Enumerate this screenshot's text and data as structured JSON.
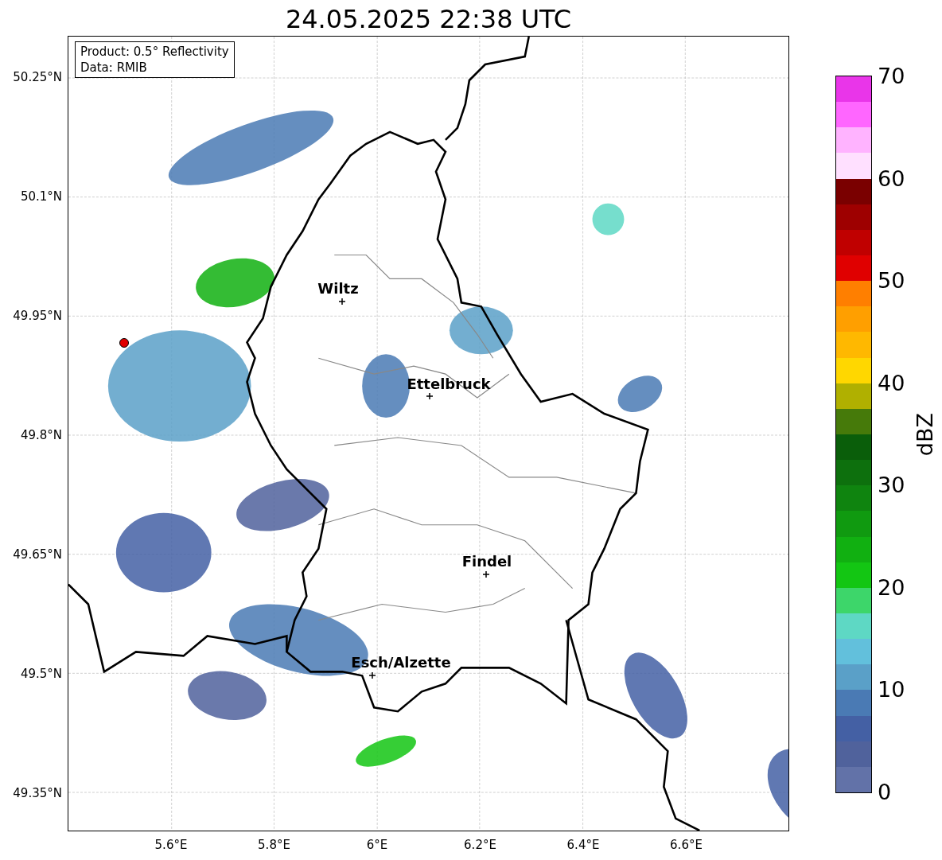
{
  "title": "24.05.2025 22:38 UTC",
  "info_box": [
    "Product: 0.5° Reflectivity",
    "Data: RMIB"
  ],
  "y_ticks": [
    "50.25°N",
    "50.1°N",
    "49.95°N",
    "49.8°N",
    "49.65°N",
    "49.5°N",
    "49.35°N"
  ],
  "x_ticks": [
    "5.6°E",
    "5.8°E",
    "6°E",
    "6.2°E",
    "6.4°E",
    "6.6°E"
  ],
  "cities": [
    {
      "name": "Wiltz"
    },
    {
      "name": "Ettelbruck"
    },
    {
      "name": "Findel"
    },
    {
      "name": "Esch/Alzette"
    }
  ],
  "colorbar": {
    "label": "dBZ",
    "ticks": [
      "70",
      "60",
      "50",
      "40",
      "30",
      "20",
      "10",
      "0"
    ],
    "segments": [
      {
        "color": "#e935e9"
      },
      {
        "color": "#ff66ff"
      },
      {
        "color": "#ffb3ff"
      },
      {
        "color": "#ffe0ff"
      },
      {
        "color": "#7a0000"
      },
      {
        "color": "#9e0000"
      },
      {
        "color": "#c00000"
      },
      {
        "color": "#e00000"
      },
      {
        "color": "#ff7f00"
      },
      {
        "color": "#ff9f00"
      },
      {
        "color": "#ffb800"
      },
      {
        "color": "#ffd700"
      },
      {
        "color": "#b0b000"
      },
      {
        "color": "#467a0a"
      },
      {
        "color": "#0a5e0a"
      },
      {
        "color": "#0d700d"
      },
      {
        "color": "#0f840f"
      },
      {
        "color": "#109a10"
      },
      {
        "color": "#11b011"
      },
      {
        "color": "#13c613"
      },
      {
        "color": "#3dd66a"
      },
      {
        "color": "#5ed8c4"
      },
      {
        "color": "#62c0dc"
      },
      {
        "color": "#5aa0c8"
      },
      {
        "color": "#4a7ab4"
      },
      {
        "color": "#4460a4"
      },
      {
        "color": "#50629c"
      },
      {
        "color": "#6272a8"
      }
    ]
  }
}
